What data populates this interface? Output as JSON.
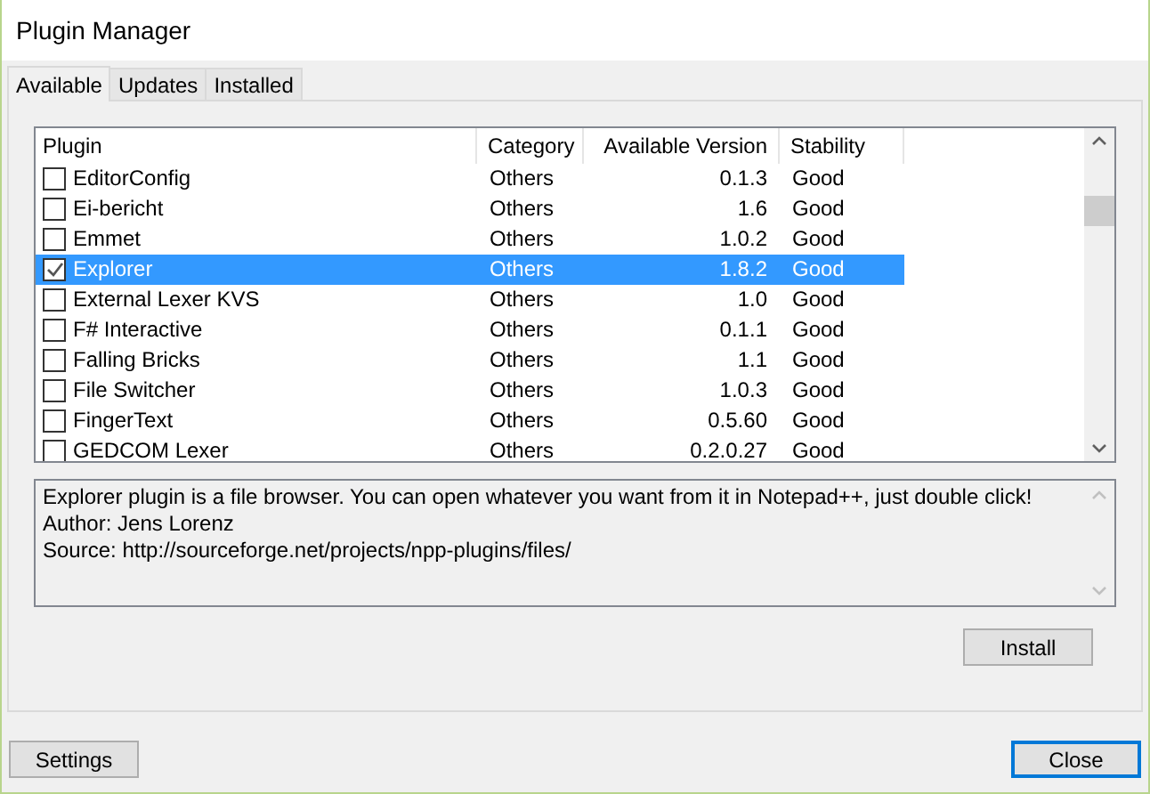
{
  "window": {
    "title": "Plugin Manager"
  },
  "tabs": [
    {
      "label": "Available",
      "selected": true
    },
    {
      "label": "Updates",
      "selected": false
    },
    {
      "label": "Installed",
      "selected": false
    }
  ],
  "table": {
    "columns": [
      "Plugin",
      "Category",
      "Available Version",
      "Stability"
    ],
    "rows": [
      {
        "checked": false,
        "selected": false,
        "cells": [
          "EditorConfig",
          "Others",
          "0.1.3",
          "Good"
        ]
      },
      {
        "checked": false,
        "selected": false,
        "cells": [
          "Ei-bericht",
          "Others",
          "1.6",
          "Good"
        ]
      },
      {
        "checked": false,
        "selected": false,
        "cells": [
          "Emmet",
          "Others",
          "1.0.2",
          "Good"
        ]
      },
      {
        "checked": true,
        "selected": true,
        "cells": [
          "Explorer",
          "Others",
          "1.8.2",
          "Good"
        ]
      },
      {
        "checked": false,
        "selected": false,
        "cells": [
          "External Lexer KVS",
          "Others",
          "1.0",
          "Good"
        ]
      },
      {
        "checked": false,
        "selected": false,
        "cells": [
          "F# Interactive",
          "Others",
          "0.1.1",
          "Good"
        ]
      },
      {
        "checked": false,
        "selected": false,
        "cells": [
          "Falling Bricks",
          "Others",
          "1.1",
          "Good"
        ]
      },
      {
        "checked": false,
        "selected": false,
        "cells": [
          "File Switcher",
          "Others",
          "1.0.3",
          "Good"
        ]
      },
      {
        "checked": false,
        "selected": false,
        "cells": [
          "FingerText",
          "Others",
          "0.5.60",
          "Good"
        ]
      },
      {
        "checked": false,
        "selected": false,
        "cells": [
          "GEDCOM Lexer",
          "Others",
          "0.2.0.27",
          "Good"
        ]
      }
    ]
  },
  "description": [
    "Explorer plugin is a file browser. You can open whatever you want from it in Notepad++, just double click!",
    "Author: Jens Lorenz",
    "Source: http://sourceforge.net/projects/npp-plugins/files/"
  ],
  "install_button": "Install",
  "buttons": [
    {
      "label": "Settings",
      "default": false
    },
    {
      "label": "Close",
      "default": true
    }
  ]
}
